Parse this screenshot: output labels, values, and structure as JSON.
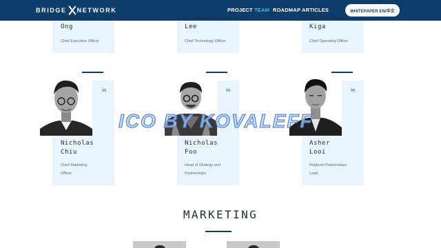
{
  "header": {
    "logo_left": "BRIDGE",
    "logo_right": "NETWORK",
    "nav": [
      "PROJECT",
      "TEAM",
      "ROADMAP",
      "ARTICLES"
    ],
    "active_nav": "TEAM",
    "whitepaper_button": "WHITEPAPER EN/中文"
  },
  "top_cards": [
    {
      "name": "Jody\nOng",
      "role": "Chief Executive Officer"
    },
    {
      "name": "Joseph\nLee",
      "role": "Chief Technology Officer"
    },
    {
      "name": "Sebastian\nKiga",
      "role": "Chief Operating Officer"
    }
  ],
  "members": [
    {
      "name": "Nicholas\nChiu",
      "role": "Chief Marketing\nOfficer",
      "linkedin": "in"
    },
    {
      "name": "Nicholas\nFoo",
      "role": "Head of Strategy and\nPartnerships",
      "linkedin": "in"
    },
    {
      "name": "Asher\nLooi",
      "role": "Regional Partnerships\nLead",
      "linkedin": "in"
    }
  ],
  "watermark": "ICO BY KOVALEFF",
  "section_title": "MARKETING"
}
